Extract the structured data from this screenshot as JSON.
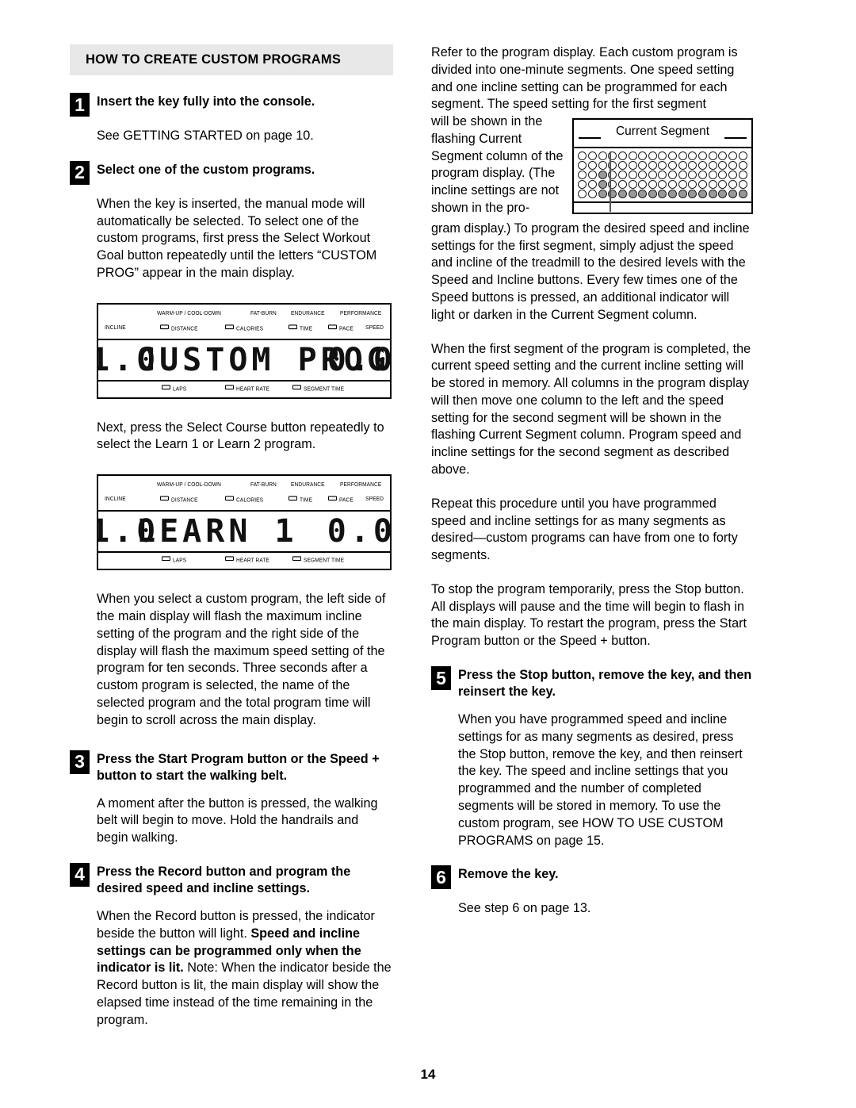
{
  "page": {
    "number": "14",
    "section_title": "HOW TO CREATE CUSTOM PROGRAMS"
  },
  "left_column": {
    "step1": {
      "num": "1",
      "title": "Insert the key fully into the console.",
      "body": "See GETTING STARTED on page 10."
    },
    "step2": {
      "num": "2",
      "title": "Select one of the custom programs.",
      "body": "When the key is inserted, the manual mode will automatically be selected. To select one of the custom programs, first press the Select Workout Goal button repeatedly until the letters “CUSTOM PROG” appear in the main display.",
      "body2": "Next, press the Select Course button repeatedly to select the Learn 1 or Learn 2 program.",
      "body3": "When you select a custom program, the left side of the main display will flash the maximum incline setting of the program and the right side of the display will flash the maximum speed setting of the program for ten seconds. Three seconds after a custom program is selected, the name of the selected program and the total program time will begin to scroll across the main display."
    },
    "step3": {
      "num": "3",
      "title": "Press the Start Program button or the Speed + button to start the walking belt.",
      "body": "A moment after the button is pressed, the walking belt will begin to move. Hold the handrails and begin walking."
    },
    "step4": {
      "num": "4",
      "title": "Press the Record button and program the desired speed and incline settings.",
      "body_part1": "When the Record button is pressed, the indicator beside the button will light. ",
      "body_bold": "Speed and incline settings can be programmed only when the indicator is lit.",
      "body_part2": " Note: When the indicator beside the Record button is lit, the main display will show the elapsed time instead of the time remaining in the program."
    }
  },
  "right_column": {
    "para1": "Refer to the program display. Each custom program is divided into one-minute segments. One speed setting and one incline setting can be programmed for each segment. The speed setting for the first segment",
    "para1_wrap": "will be shown in the flashing Current Segment column of the program display. (The incline settings are not shown in the pro-",
    "para2": "gram display.) To program the desired speed and incline settings for the first segment, simply adjust the speed and incline of the treadmill to the desired levels with the Speed and Incline buttons. Every few times one of the Speed buttons is pressed, an additional indicator will light or darken in the Current Segment column.",
    "para3": "When the first segment of the program is completed, the current speed setting and the current incline setting will be stored in memory. All columns in the program display will then move one column to the left and the speed setting for the second segment will be shown in the flashing Current Segment column. Program speed and incline settings for the second segment as described above.",
    "para4": "Repeat this procedure until you have programmed speed and incline settings for as many segments as desired—custom programs can have from one to forty segments.",
    "para5": "To stop the program temporarily, press the Stop button. All displays will pause and the time will begin to flash in the main display. To restart the program, press the Start Program button or the Speed + button.",
    "step5": {
      "num": "5",
      "title": "Press the Stop button, remove the key, and then reinsert the key.",
      "body": "When you have programmed speed and incline settings for as many segments as desired, press the Stop button, remove the key, and then reinsert the key. The speed and incline settings that you programmed and the number of completed segments will be stored in memory. To use the custom program, see HOW TO USE CUSTOM PROGRAMS on page 15."
    },
    "step6": {
      "num": "6",
      "title": "Remove the key.",
      "body": "See step 6 on page 13."
    }
  },
  "console_display_1": {
    "labels_row1": [
      "WARM-UP / COOL-DOWN",
      "FAT-BURN",
      "ENDURANCE",
      "PERFORMANCE"
    ],
    "labels_row2": [
      "INCLINE",
      "DISTANCE",
      "CALORIES",
      "TIME",
      "PACE",
      "SPEED"
    ],
    "labels_row3": [
      "LAPS",
      "HEART RATE",
      "SEGMENT TIME"
    ],
    "left_value": "1.0",
    "main_value": "CUSTOM PROG",
    "right_value": "0.0"
  },
  "console_display_2": {
    "labels_row1": [
      "WARM-UP / COOL-DOWN",
      "FAT-BURN",
      "ENDURANCE",
      "PERFORMANCE"
    ],
    "labels_row2": [
      "INCLINE",
      "DISTANCE",
      "CALORIES",
      "TIME",
      "PACE",
      "SPEED"
    ],
    "labels_row3": [
      "LAPS",
      "HEART RATE",
      "SEGMENT TIME"
    ],
    "left_value": "1.0",
    "main_value": "LEARN 1",
    "right_value": "0.0"
  },
  "segment_display": {
    "title": "Current Segment",
    "columns": 17,
    "rows": 5,
    "current_segment_column_index": 2,
    "grid": [
      [
        0,
        0,
        0,
        0,
        0,
        0,
        0,
        0,
        0,
        0,
        0,
        0,
        0,
        0,
        0,
        0,
        0
      ],
      [
        0,
        0,
        0,
        0,
        0,
        0,
        0,
        0,
        0,
        0,
        0,
        0,
        0,
        0,
        0,
        0,
        0
      ],
      [
        0,
        0,
        1,
        0,
        0,
        0,
        0,
        0,
        0,
        0,
        0,
        0,
        0,
        0,
        0,
        0,
        0
      ],
      [
        0,
        0,
        1,
        0,
        0,
        0,
        0,
        0,
        0,
        0,
        0,
        0,
        0,
        0,
        0,
        0,
        0
      ],
      [
        0,
        0,
        1,
        1,
        1,
        1,
        1,
        1,
        1,
        1,
        1,
        1,
        1,
        1,
        1,
        1,
        1
      ]
    ],
    "dot_on_color": "#999999",
    "dot_off_color": "#ffffff"
  }
}
